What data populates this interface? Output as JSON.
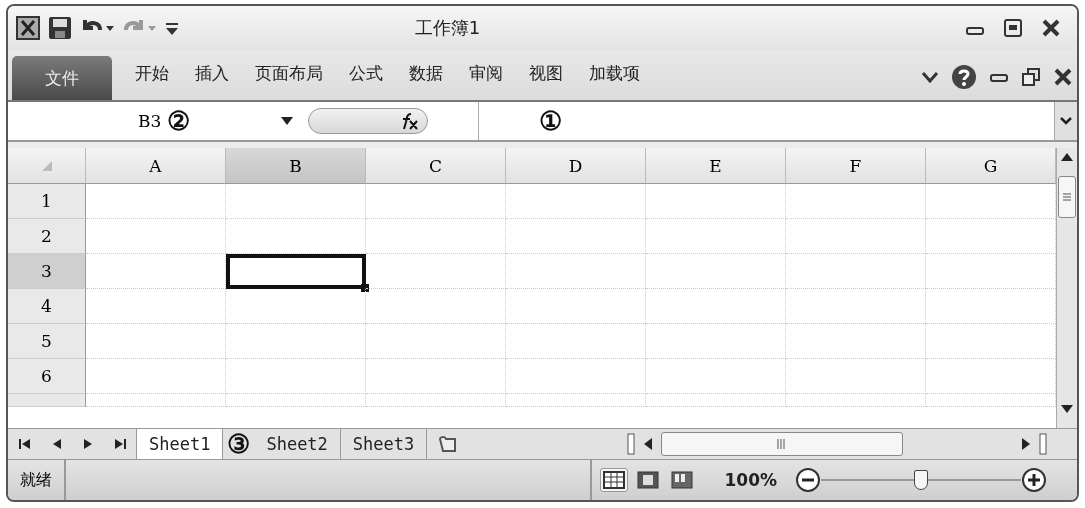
{
  "window": {
    "title": "工作簿1"
  },
  "ribbon_tabs": [
    {
      "label": "文件",
      "kind": "file"
    },
    {
      "label": "开始",
      "kind": "tab"
    },
    {
      "label": "插入",
      "kind": "tab"
    },
    {
      "label": "页面布局",
      "kind": "tab"
    },
    {
      "label": "公式",
      "kind": "tab"
    },
    {
      "label": "数据",
      "kind": "tab"
    },
    {
      "label": "审阅",
      "kind": "tab"
    },
    {
      "label": "视图",
      "kind": "tab"
    },
    {
      "label": "加载项",
      "kind": "tab"
    }
  ],
  "formula_bar": {
    "name_box": "B3",
    "name_box_callout": "②",
    "formula_callout": "①"
  },
  "columns": [
    {
      "label": "A",
      "selected": false
    },
    {
      "label": "B",
      "selected": true
    },
    {
      "label": "C",
      "selected": false
    },
    {
      "label": "D",
      "selected": false
    },
    {
      "label": "E",
      "selected": false
    },
    {
      "label": "F",
      "selected": false
    },
    {
      "label": "G",
      "selected": false
    }
  ],
  "rows": [
    {
      "label": "1",
      "selected": false
    },
    {
      "label": "2",
      "selected": false
    },
    {
      "label": "3",
      "selected": true
    },
    {
      "label": "4",
      "selected": false
    },
    {
      "label": "5",
      "selected": false
    },
    {
      "label": "6",
      "selected": false
    }
  ],
  "sheet_tabs": [
    {
      "label": "Sheet1",
      "selected": true
    },
    {
      "label": "Sheet2",
      "selected": false
    },
    {
      "label": "Sheet3",
      "selected": false
    }
  ],
  "sheet_tab_callout": "③",
  "status_bar": {
    "status": "就绪",
    "views": [
      {
        "kind": "normal",
        "selected": true
      },
      {
        "kind": "page-layout",
        "selected": false
      },
      {
        "kind": "page-break",
        "selected": false
      }
    ],
    "zoom": "100%",
    "zoom_slider": {
      "level": 0.5
    }
  }
}
